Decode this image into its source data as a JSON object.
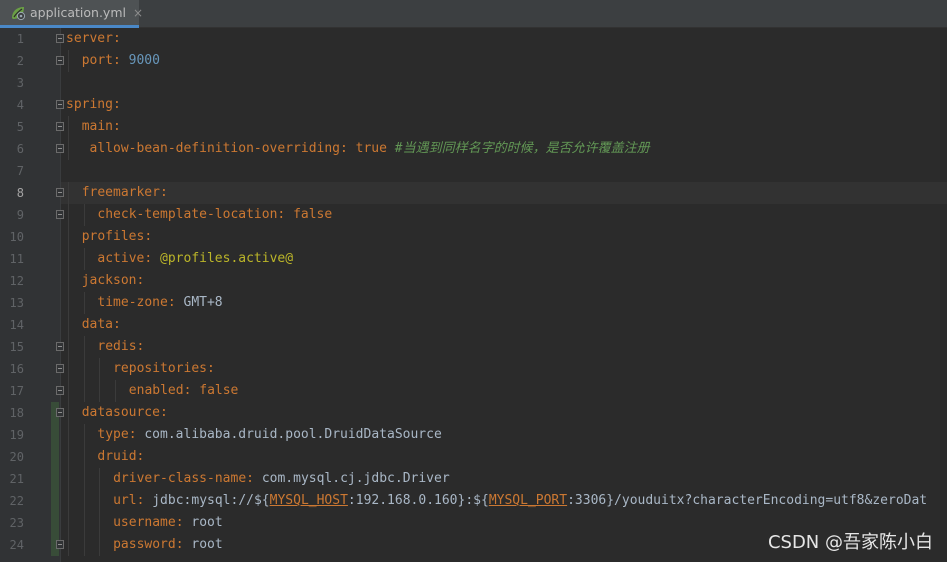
{
  "tab": {
    "file_name": "application.yml",
    "close_glyph": "×",
    "icon": "yaml-spring-file-icon"
  },
  "colors": {
    "key": "#cc7832",
    "number": "#6897bb",
    "comment": "#629755",
    "annotation": "#bbb529",
    "text": "#a9b7c6",
    "tab_underline": "#4a88c7"
  },
  "editor": {
    "current_line": 8,
    "lines": [
      {
        "n": "1",
        "indent": 0,
        "tokens": [
          {
            "t": "key",
            "v": "server"
          },
          {
            "t": "punct",
            "v": ":"
          }
        ]
      },
      {
        "n": "2",
        "indent": 1,
        "tokens": [
          {
            "t": "key",
            "v": "port"
          },
          {
            "t": "punct",
            "v": ": "
          },
          {
            "t": "val-num",
            "v": "9000"
          }
        ]
      },
      {
        "n": "3",
        "indent": 0,
        "tokens": []
      },
      {
        "n": "4",
        "indent": 0,
        "tokens": [
          {
            "t": "key",
            "v": "spring"
          },
          {
            "t": "punct",
            "v": ":"
          }
        ]
      },
      {
        "n": "5",
        "indent": 1,
        "tokens": [
          {
            "t": "key",
            "v": "main"
          },
          {
            "t": "punct",
            "v": ":"
          }
        ]
      },
      {
        "n": "6",
        "indent": 1.5,
        "tokens": [
          {
            "t": "key",
            "v": "allow-bean-definition-overriding"
          },
          {
            "t": "punct",
            "v": ": "
          },
          {
            "t": "val-bool",
            "v": "true "
          },
          {
            "t": "comment",
            "v": "#当遇到同样名字的时候，是否允许覆盖注册"
          }
        ]
      },
      {
        "n": "7",
        "indent": 0,
        "tokens": []
      },
      {
        "n": "8",
        "indent": 1,
        "tokens": [
          {
            "t": "key",
            "v": "freemarker"
          },
          {
            "t": "punct",
            "v": ":"
          }
        ]
      },
      {
        "n": "9",
        "indent": 2,
        "tokens": [
          {
            "t": "key",
            "v": "check-template-location"
          },
          {
            "t": "punct",
            "v": ": "
          },
          {
            "t": "val-bool",
            "v": "false"
          }
        ]
      },
      {
        "n": "10",
        "indent": 1,
        "tokens": [
          {
            "t": "key",
            "v": "profiles"
          },
          {
            "t": "punct",
            "v": ":"
          }
        ]
      },
      {
        "n": "11",
        "indent": 2,
        "tokens": [
          {
            "t": "key",
            "v": "active"
          },
          {
            "t": "punct",
            "v": ": "
          },
          {
            "t": "val-anno",
            "v": "@profiles.active@"
          }
        ]
      },
      {
        "n": "12",
        "indent": 1,
        "tokens": [
          {
            "t": "key",
            "v": "jackson"
          },
          {
            "t": "punct",
            "v": ":"
          }
        ]
      },
      {
        "n": "13",
        "indent": 2,
        "tokens": [
          {
            "t": "key",
            "v": "time-zone"
          },
          {
            "t": "punct",
            "v": ": "
          },
          {
            "t": "val-text",
            "v": "GMT+8"
          }
        ]
      },
      {
        "n": "14",
        "indent": 1,
        "tokens": [
          {
            "t": "key",
            "v": "data"
          },
          {
            "t": "punct",
            "v": ":"
          }
        ]
      },
      {
        "n": "15",
        "indent": 2,
        "tokens": [
          {
            "t": "key",
            "v": "redis"
          },
          {
            "t": "punct",
            "v": ":"
          }
        ]
      },
      {
        "n": "16",
        "indent": 3,
        "tokens": [
          {
            "t": "key",
            "v": "repositories"
          },
          {
            "t": "punct",
            "v": ":"
          }
        ]
      },
      {
        "n": "17",
        "indent": 4,
        "tokens": [
          {
            "t": "key",
            "v": "enabled"
          },
          {
            "t": "punct",
            "v": ": "
          },
          {
            "t": "val-bool",
            "v": "false"
          }
        ]
      },
      {
        "n": "18",
        "indent": 1,
        "tokens": [
          {
            "t": "key",
            "v": "datasource"
          },
          {
            "t": "punct",
            "v": ":"
          }
        ]
      },
      {
        "n": "19",
        "indent": 2,
        "tokens": [
          {
            "t": "key",
            "v": "type"
          },
          {
            "t": "punct",
            "v": ": "
          },
          {
            "t": "val-text",
            "v": "com.alibaba.druid.pool.DruidDataSource"
          }
        ]
      },
      {
        "n": "20",
        "indent": 2,
        "tokens": [
          {
            "t": "key",
            "v": "druid"
          },
          {
            "t": "punct",
            "v": ":"
          }
        ]
      },
      {
        "n": "21",
        "indent": 3,
        "tokens": [
          {
            "t": "key",
            "v": "driver-class-name"
          },
          {
            "t": "punct",
            "v": ": "
          },
          {
            "t": "val-text",
            "v": "com.mysql.cj.jdbc.Driver"
          }
        ]
      },
      {
        "n": "22",
        "indent": 3,
        "tokens": [
          {
            "t": "key",
            "v": "url"
          },
          {
            "t": "punct",
            "v": ": "
          },
          {
            "t": "val-text",
            "v": "jdbc:mysql://${"
          },
          {
            "t": "env",
            "v": "MYSQL_HOST"
          },
          {
            "t": "val-text",
            "v": ":192.168.0.160}:${"
          },
          {
            "t": "env",
            "v": "MYSQL_PORT"
          },
          {
            "t": "val-text",
            "v": ":3306}/youduitx?characterEncoding=utf8&zeroDat"
          }
        ]
      },
      {
        "n": "23",
        "indent": 3,
        "tokens": [
          {
            "t": "key",
            "v": "username"
          },
          {
            "t": "punct",
            "v": ": "
          },
          {
            "t": "val-text",
            "v": "root"
          }
        ]
      },
      {
        "n": "24",
        "indent": 3,
        "tokens": [
          {
            "t": "key",
            "v": "password"
          },
          {
            "t": "punct",
            "v": ": "
          },
          {
            "t": "val-text",
            "v": "root"
          }
        ]
      }
    ]
  },
  "watermark": "CSDN @吾家陈小白"
}
